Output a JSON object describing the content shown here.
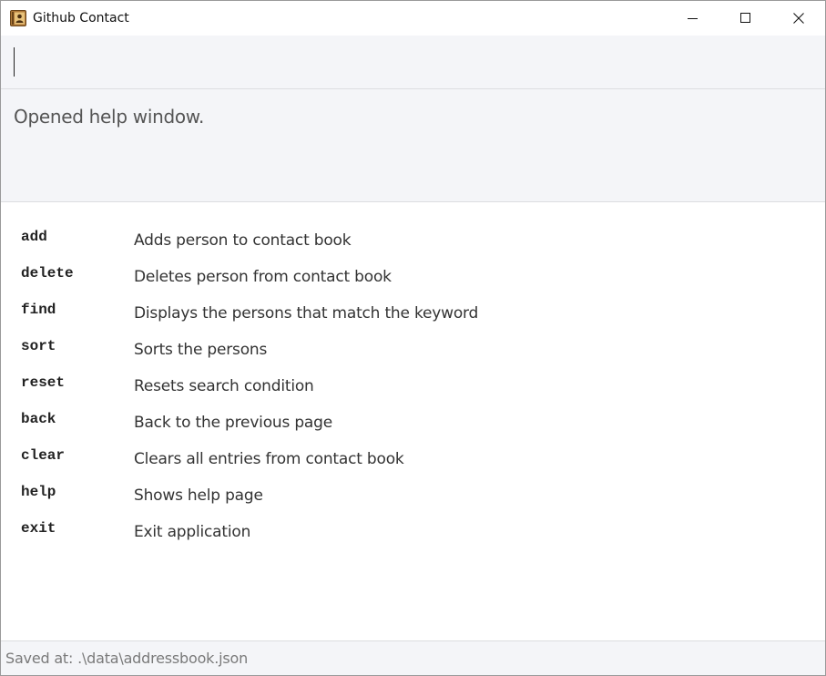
{
  "window": {
    "title": "Github Contact",
    "controls": {
      "minimize": "minimize-icon",
      "maximize": "maximize-icon",
      "close": "close-icon"
    }
  },
  "command_box": {
    "value": "",
    "placeholder": ""
  },
  "result_display": {
    "text": "Opened help window."
  },
  "help": {
    "commands": [
      {
        "command": "add",
        "description": "Adds person to contact book"
      },
      {
        "command": "delete",
        "description": "Deletes person from contact book"
      },
      {
        "command": "find",
        "description": "Displays the persons that match the keyword"
      },
      {
        "command": "sort",
        "description": "Sorts the persons"
      },
      {
        "command": "reset",
        "description": "Resets search condition"
      },
      {
        "command": "back",
        "description": "Back to the previous page"
      },
      {
        "command": "clear",
        "description": "Clears all entries from contact book"
      },
      {
        "command": "help",
        "description": "Shows help page"
      },
      {
        "command": "exit",
        "description": "Exit application"
      }
    ]
  },
  "status_bar": {
    "text": "Saved at: .\\data\\addressbook.json"
  },
  "colors": {
    "panel_background": "#f4f5f8",
    "app_icon": "#b07a3a"
  }
}
